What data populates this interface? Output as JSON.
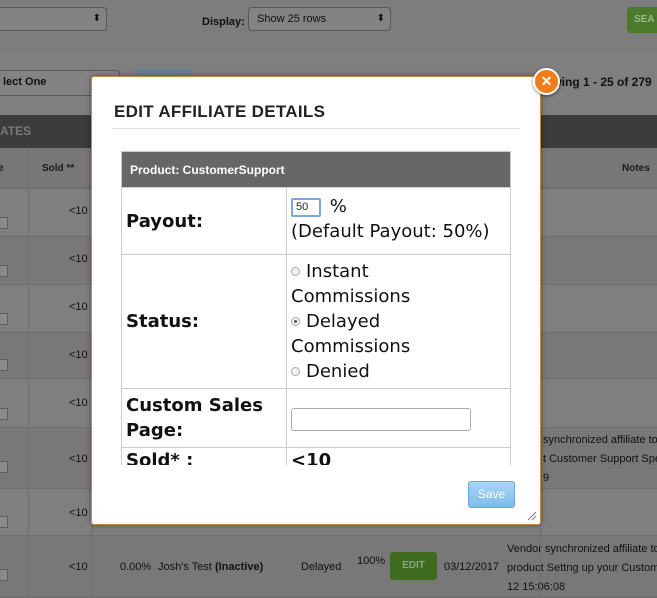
{
  "background": {
    "filter_select_value": "",
    "display_label": "Display:",
    "display_select_value": "Show 25 rows",
    "search_button": "SEA",
    "select_one_value": "lect One",
    "showing_text": "owing 1 - 25 of 279",
    "section_header": "ATES",
    "columns": {
      "sold": "Sold **",
      "notes": "Notes"
    },
    "rows": [
      {
        "sold": "<10"
      },
      {
        "sold": "<10"
      },
      {
        "sold": "<10"
      },
      {
        "sold": "<10"
      },
      {
        "sold": "<10"
      },
      {
        "sold": "<10",
        "notes": [
          "synchronized affiliate to",
          "t Customer Support Spe",
          "9"
        ]
      },
      {
        "sold": "<10"
      },
      {
        "sold": "<10",
        "conv": "0.00%",
        "product": "Josh's Test",
        "product_status": "(Inactive)",
        "status": "Delayed",
        "payout": "100%",
        "edit": "EDIT",
        "date": "03/12/2017",
        "notes": [
          "Vendor synchronized affiliate to",
          "product Settng up your Custome",
          "12 15:06:08"
        ]
      }
    ]
  },
  "modal": {
    "title": "EDIT AFFILIATE DETAILS",
    "product_header": "Product: CustomerSupport",
    "payout": {
      "label": "Payout:",
      "value": "50",
      "unit": "%",
      "default_text": "(Default Payout: 50%)"
    },
    "status": {
      "label": "Status:",
      "options": [
        {
          "line1": "Instant",
          "line2": "Commissions",
          "selected": false
        },
        {
          "line1": "Delayed",
          "line2": "Commissions",
          "selected": true
        },
        {
          "line1": "Denied",
          "line2": "",
          "selected": false
        }
      ]
    },
    "custom_sales_page": {
      "label_line1": "Custom Sales",
      "label_line2": "Page:",
      "value": ""
    },
    "sold": {
      "label": "Sold* :",
      "value": "<10"
    },
    "save_label": "Save",
    "close_glyph": "✕"
  },
  "colors": {
    "accent_orange": "#f07c1a",
    "save_blue": "#7ebbe9",
    "header_gray": "#666666"
  }
}
